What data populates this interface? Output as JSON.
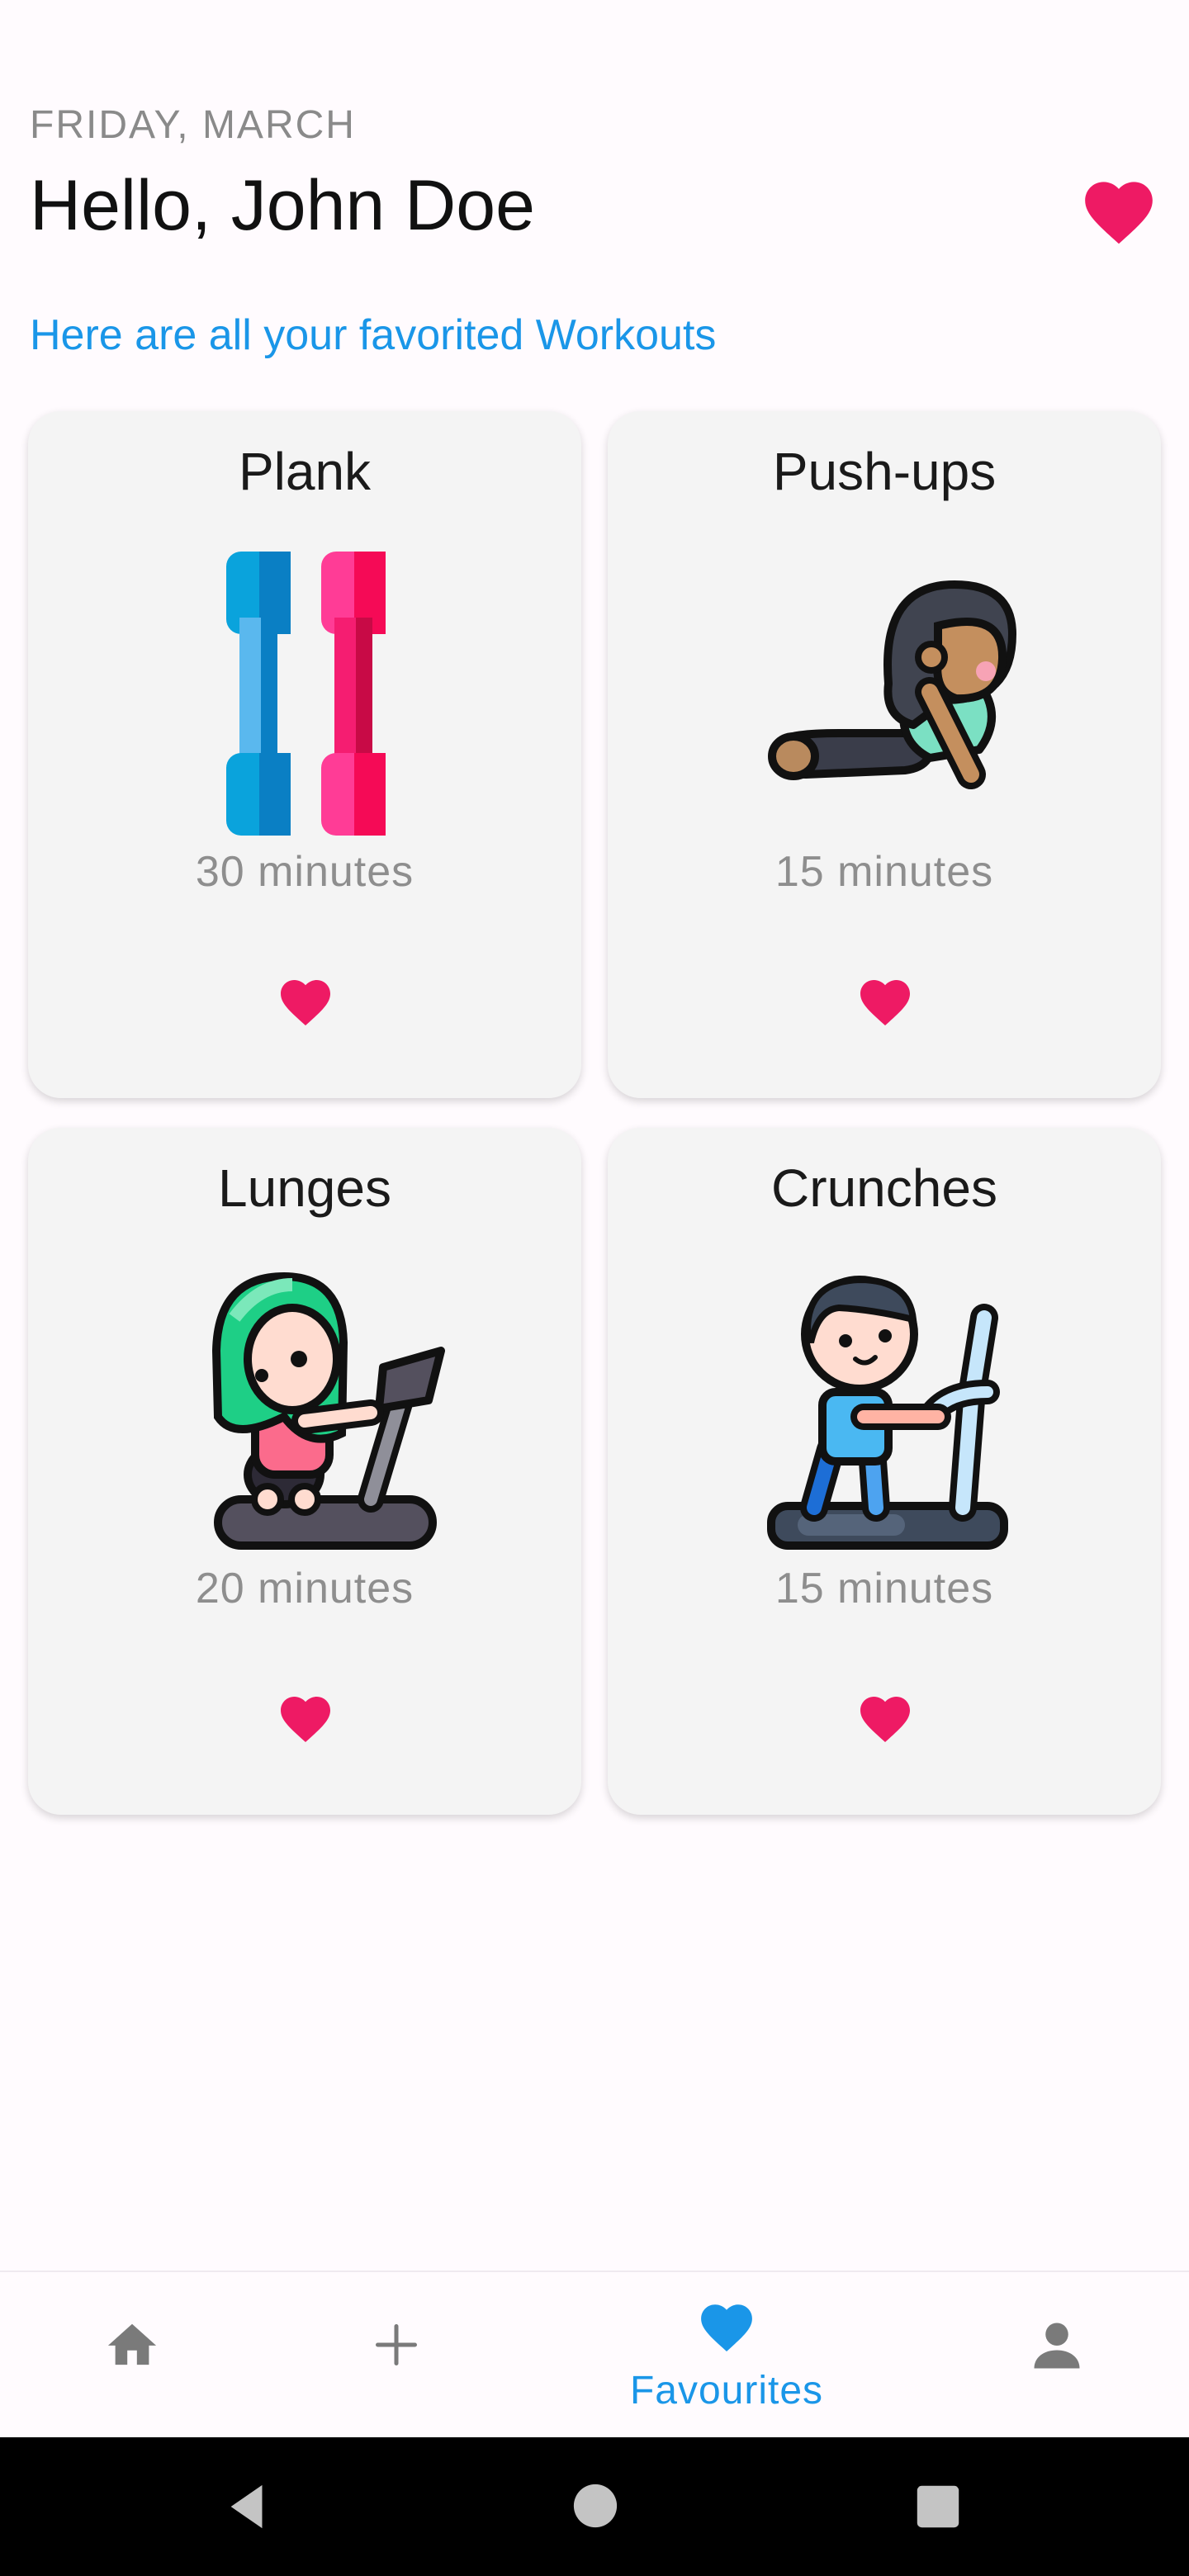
{
  "header": {
    "date": "FRIDAY, MARCH",
    "greeting": "Hello, John Doe"
  },
  "subtitle": "Here are all your favorited Workouts",
  "colors": {
    "accent": "#1a96e8",
    "heart": "#ee1a64",
    "card_bg": "#f4f4f4",
    "muted_text": "#8e8e8e"
  },
  "workouts": [
    {
      "title": "Plank",
      "duration": "30 minutes",
      "icon": "dumbbells-icon"
    },
    {
      "title": "Push-ups",
      "duration": "15 minutes",
      "icon": "pushup-person-icon"
    },
    {
      "title": "Lunges",
      "duration": "20 minutes",
      "icon": "treadmill-girl-icon"
    },
    {
      "title": "Crunches",
      "duration": "15 minutes",
      "icon": "treadmill-boy-icon"
    }
  ],
  "bottom_nav": {
    "items": [
      {
        "icon": "home-icon",
        "label": ""
      },
      {
        "icon": "plus-icon",
        "label": ""
      },
      {
        "icon": "heart-icon",
        "label": "Favourites",
        "active": true
      },
      {
        "icon": "person-icon",
        "label": ""
      }
    ]
  },
  "system_nav": [
    "back-icon",
    "home-circle-icon",
    "recents-icon"
  ]
}
